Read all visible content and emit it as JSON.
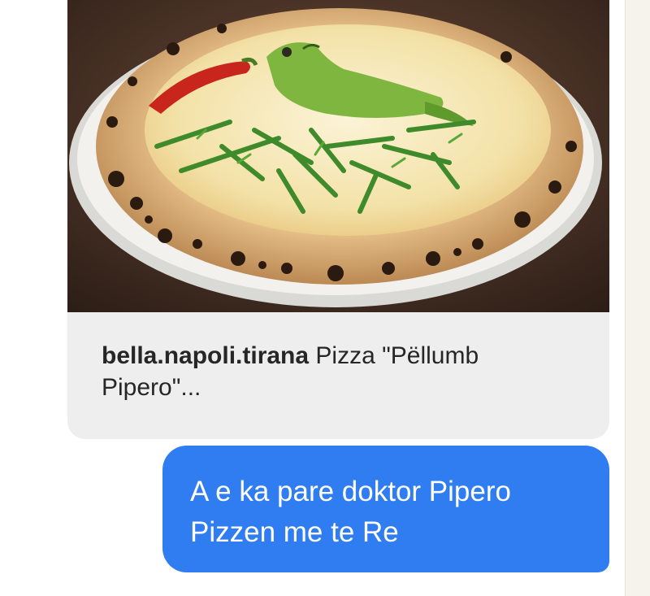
{
  "shared_post": {
    "image_icon": "pizza-photo",
    "username": "bella.napoli.tirana",
    "caption_line1": "Pizza \"Pëllumb",
    "caption_line2": "Pipero\"..."
  },
  "message": {
    "line1": "A e ka pare doktor Pipero",
    "line2": "Pizzen me te Re",
    "bubble_color": "#2f7df0"
  }
}
